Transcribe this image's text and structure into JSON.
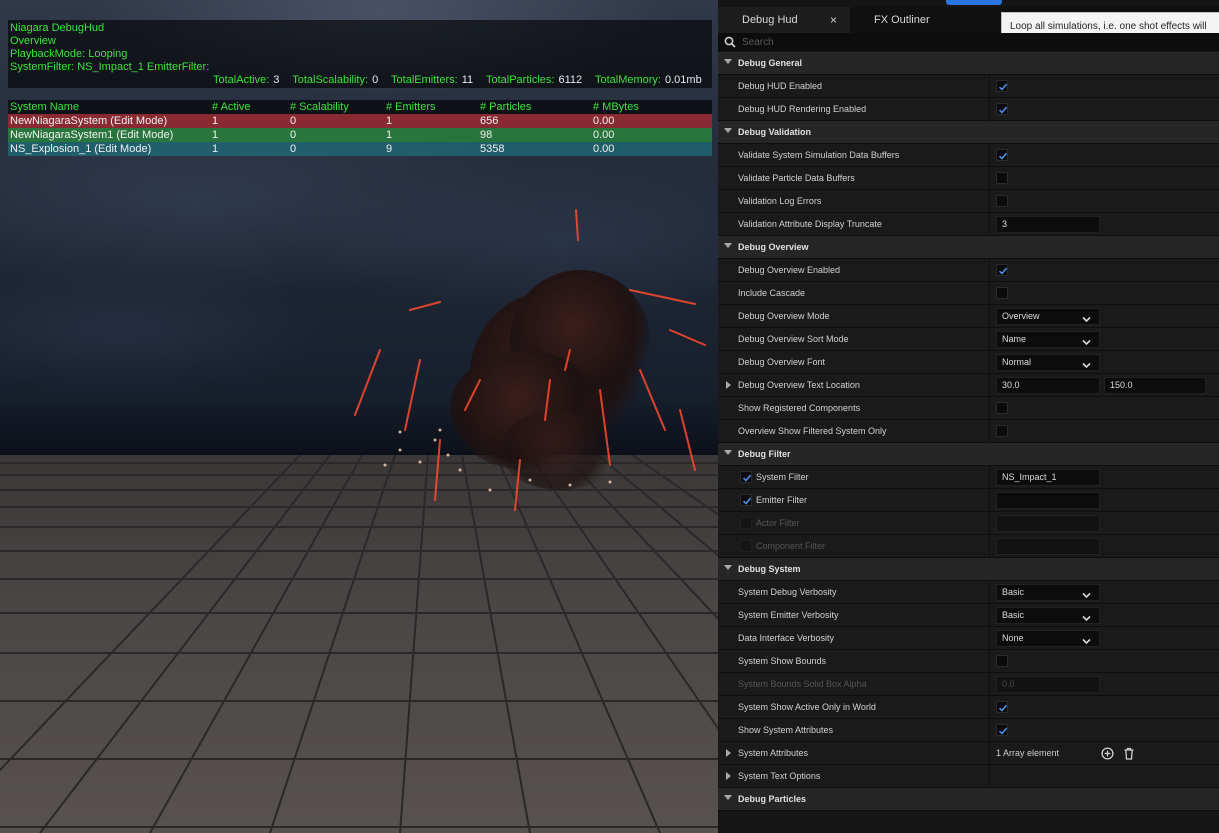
{
  "hud": {
    "title": "Niagara DebugHud",
    "overview": "Overview",
    "playback": "PlaybackMode: Looping",
    "filters": "SystemFilter: NS_Impact_1    EmitterFilter:",
    "totals": [
      {
        "label": "TotalActive:",
        "value": "3"
      },
      {
        "label": "TotalScalability:",
        "value": "0"
      },
      {
        "label": "TotalEmitters:",
        "value": "11"
      },
      {
        "label": "TotalParticles:",
        "value": "6112"
      },
      {
        "label": "TotalMemory:",
        "value": "0.01mb"
      }
    ],
    "columns": [
      "System Name",
      "# Active",
      "# Scalability",
      "# Emitters",
      "# Particles",
      "# MBytes"
    ],
    "rows": [
      [
        "NewNiagaraSystem (Edit Mode)",
        "1",
        "0",
        "1",
        "656",
        "0.00"
      ],
      [
        "NewNiagaraSystem1 (Edit Mode)",
        "1",
        "0",
        "1",
        "98",
        "0.00"
      ],
      [
        "NS_Explosion_1 (Edit Mode)",
        "1",
        "0",
        "9",
        "5358",
        "0.00"
      ]
    ]
  },
  "panel": {
    "tabs": [
      {
        "label": "Debug Hud",
        "active": true
      },
      {
        "label": "FX Outliner",
        "active": false
      }
    ],
    "close_glyph": "×",
    "tooltip": "Loop all simulations, i.e. one shot effects will",
    "search": {
      "placeholder": "Search",
      "value": ""
    },
    "rows": [
      {
        "kind": "cat",
        "label": "Debug General"
      },
      {
        "kind": "check",
        "label": "Debug HUD Enabled",
        "checked": true
      },
      {
        "kind": "check",
        "label": "Debug HUD Rendering Enabled",
        "checked": true
      },
      {
        "kind": "cat",
        "label": "Debug Validation"
      },
      {
        "kind": "check",
        "label": "Validate System Simulation Data Buffers",
        "checked": true
      },
      {
        "kind": "check",
        "label": "Validate Particle Data Buffers",
        "checked": false
      },
      {
        "kind": "check",
        "label": "Validation Log Errors",
        "checked": false
      },
      {
        "kind": "field",
        "label": "Validation Attribute Display Truncate",
        "value": "3"
      },
      {
        "kind": "cat",
        "label": "Debug Overview"
      },
      {
        "kind": "check",
        "label": "Debug Overview Enabled",
        "checked": true
      },
      {
        "kind": "check",
        "label": "Include Cascade",
        "checked": false
      },
      {
        "kind": "combo",
        "label": "Debug Overview Mode",
        "value": "Overview"
      },
      {
        "kind": "combo",
        "label": "Debug Overview Sort Mode",
        "value": "Name"
      },
      {
        "kind": "combo",
        "label": "Debug Overview Font",
        "value": "Normal"
      },
      {
        "kind": "field2",
        "label": "Debug Overview Text Location",
        "value": "30.0",
        "value2": "150.0",
        "expander": true
      },
      {
        "kind": "check",
        "label": "Show Registered Components",
        "checked": false
      },
      {
        "kind": "check",
        "label": "Overview Show Filtered System Only",
        "checked": false
      },
      {
        "kind": "cat",
        "label": "Debug Filter"
      },
      {
        "kind": "leadfield",
        "label": "System Filter",
        "value": "NS_Impact_1",
        "checked": true,
        "enabled": true
      },
      {
        "kind": "leadfield",
        "label": "Emitter Filter",
        "value": "",
        "checked": true,
        "enabled": true
      },
      {
        "kind": "leadfield",
        "label": "Actor Filter",
        "value": "",
        "checked": false,
        "enabled": false
      },
      {
        "kind": "leadfield",
        "label": "Component Filter",
        "value": "",
        "checked": false,
        "enabled": false
      },
      {
        "kind": "cat",
        "label": "Debug System"
      },
      {
        "kind": "combo",
        "label": "System Debug Verbosity",
        "value": "Basic"
      },
      {
        "kind": "combo",
        "label": "System Emitter Verbosity",
        "value": "Basic"
      },
      {
        "kind": "combo",
        "label": "Data Interface Verbosity",
        "value": "None"
      },
      {
        "kind": "check",
        "label": "System Show Bounds",
        "checked": false
      },
      {
        "kind": "field",
        "label": "System Bounds Solid Box Alpha",
        "value": "0.0",
        "enabled": false
      },
      {
        "kind": "check",
        "label": "System Show Active Only in World",
        "checked": true
      },
      {
        "kind": "check",
        "label": "Show System Attributes",
        "checked": true
      },
      {
        "kind": "array",
        "label": "System Attributes",
        "value": "1 Array element",
        "expander": true
      },
      {
        "kind": "plain",
        "label": "System Text Options",
        "expander": true
      },
      {
        "kind": "cat",
        "label": "Debug Particles"
      }
    ]
  },
  "colors": {
    "hud_text": "#3ce33c",
    "accent": "#2a74e0",
    "check": "#4f8fe8"
  }
}
